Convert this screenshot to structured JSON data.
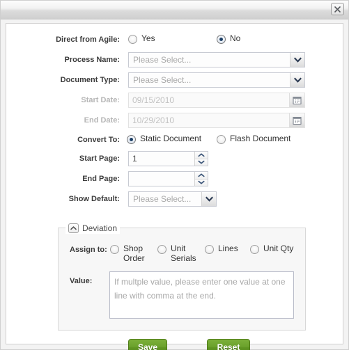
{
  "dialog": {
    "close_icon": "close-icon"
  },
  "form": {
    "direct_from_agile": {
      "label": "Direct from Agile:",
      "options": [
        {
          "label": "Yes",
          "checked": false
        },
        {
          "label": "No",
          "checked": true
        }
      ]
    },
    "process_name": {
      "label": "Process Name:",
      "value": "Please Select...",
      "icon": "chevron-down-icon"
    },
    "document_type": {
      "label": "Document Type:",
      "value": "Please Select...",
      "icon": "chevron-down-icon"
    },
    "start_date": {
      "label": "Start Date:",
      "value": "09/15/2010",
      "disabled": true,
      "icon": "calendar-icon"
    },
    "end_date": {
      "label": "End Date:",
      "value": "10/29/2010",
      "disabled": true,
      "icon": "calendar-icon"
    },
    "convert_to": {
      "label": "Convert To:",
      "options": [
        {
          "label": "Static Document",
          "checked": true
        },
        {
          "label": "Flash Document",
          "checked": false
        }
      ]
    },
    "start_page": {
      "label": "Start Page:",
      "value": "1"
    },
    "end_page": {
      "label": "End Page:",
      "value": ""
    },
    "show_default": {
      "label": "Show Default:",
      "value": "Please Select...",
      "icon": "chevron-down-icon"
    }
  },
  "deviation": {
    "title": "Deviation",
    "toggle_icon": "chevron-up-icon",
    "assign_to": {
      "label": "Assign to:",
      "options": [
        {
          "label": "Shop Order",
          "checked": false
        },
        {
          "label": "Unit Serials",
          "checked": false
        },
        {
          "label": "Lines",
          "checked": false
        },
        {
          "label": "Unit Qty",
          "checked": false
        }
      ]
    },
    "value": {
      "label": "Value:",
      "placeholder": "If multple value, please enter one value at one line with comma at the end.",
      "text": ""
    }
  },
  "actions": {
    "save": "Save",
    "reset": "Reset"
  },
  "colors": {
    "button_green": "#6aa12c",
    "button_green_border": "#4e7a18",
    "radio_dot": "#1c3f66",
    "panel_bg": "#f7f7f7"
  }
}
